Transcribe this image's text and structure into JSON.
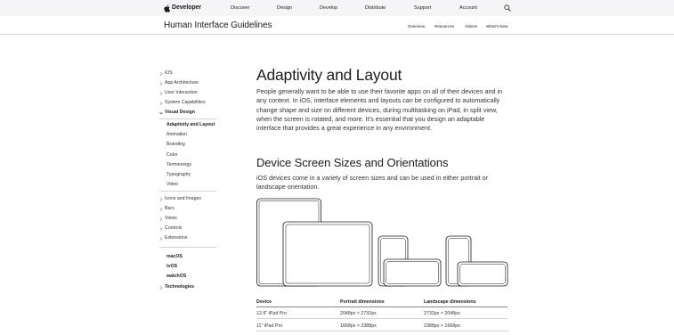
{
  "globalnav": {
    "logo_text": "Developer",
    "items": [
      "Discover",
      "Design",
      "Develop",
      "Distribute",
      "Support",
      "Account"
    ],
    "search_icon": "search-icon"
  },
  "localnav": {
    "title": "Human Interface Guidelines",
    "links": [
      "Overview",
      "Resources",
      "Videos",
      "What's New"
    ]
  },
  "sidebar": {
    "top_sections": [
      "iOS",
      "App Architecture",
      "User Interaction",
      "System Capabilities",
      "Visual Design"
    ],
    "visual_design_children": [
      "Adaptivity and Layout",
      "Animation",
      "Branding",
      "Color",
      "Terminology",
      "Typography",
      "Video"
    ],
    "active_child": "Adaptivity and Layout",
    "more_sections": [
      "Icons and Images",
      "Bars",
      "Views",
      "Controls",
      "Extensions"
    ],
    "platforms": [
      "macOS",
      "tvOS",
      "watchOS"
    ],
    "technologies": "Technologies"
  },
  "content": {
    "title": "Adaptivity and Layout",
    "intro": "People generally want to be able to use their favorite apps on all of their devices and in any context. In iOS, interface elements and layouts can be configured to automatically change shape and size on different devices, during multitasking on iPad, in split view, when the screen is rotated, and more. It’s essential that you design an adaptable interface that provides a great experience in any environment.",
    "section_title": "Device Screen Sizes and Orientations",
    "section_text": "iOS devices come in a variety of screen sizes and can be used in either portrait or landscape orientation."
  },
  "table": {
    "headers": [
      "Device",
      "Portrait dimensions",
      "Landscape dimensions"
    ],
    "rows": [
      [
        "12.9\" iPad Pro",
        "2048px × 2732px",
        "2732px × 2048px"
      ],
      [
        "11\" iPad Pro",
        "1668px × 2388px",
        "2388px × 1668px"
      ]
    ]
  },
  "colors": {
    "nav_bg": "#f5f5f7",
    "text": "#1d1d1f",
    "body_text": "#333336",
    "divider": "#d2d2d7",
    "device_stroke": "#1d1d1f"
  }
}
